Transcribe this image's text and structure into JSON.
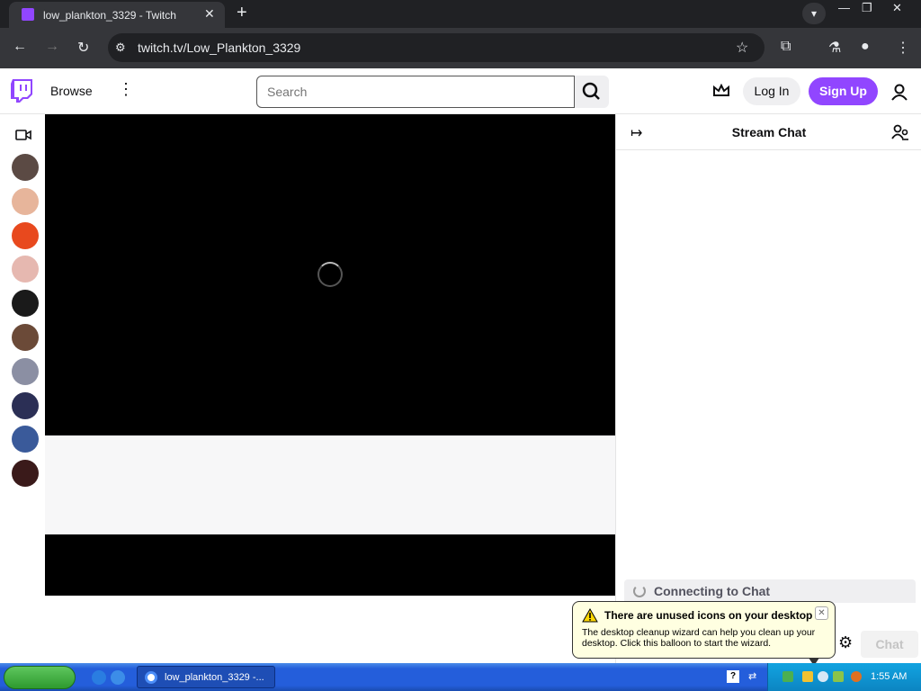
{
  "browser": {
    "tab_title": "low_plankton_3329 - Twitch",
    "tab_close": "✕",
    "new_tab": "+",
    "url": "twitch.tv/Low_Plankton_3329",
    "window_controls": {
      "minimize": "—",
      "restore": "❐",
      "close": "✕"
    },
    "nav": {
      "back": "←",
      "forward": "→",
      "reload": "↻"
    }
  },
  "twitch": {
    "nav": {
      "browse_label": "Browse",
      "search_placeholder": "Search",
      "login_label": "Log In",
      "signup_label": "Sign Up"
    },
    "sidebar": {
      "channels": [
        {
          "name": "avatar-1",
          "color": "#5b4a44"
        },
        {
          "name": "avatar-2",
          "color": "#e7b59b"
        },
        {
          "name": "avatar-3",
          "color": "#e8491e"
        },
        {
          "name": "avatar-4",
          "color": "#e6b8b0"
        },
        {
          "name": "avatar-5",
          "color": "#1a1a1a"
        },
        {
          "name": "avatar-6",
          "color": "#6b4a38"
        },
        {
          "name": "avatar-7",
          "color": "#8b8fa3"
        },
        {
          "name": "avatar-8",
          "color": "#2b2f55"
        },
        {
          "name": "avatar-9",
          "color": "#3a5a9a"
        },
        {
          "name": "avatar-10",
          "color": "#3a1a1a"
        }
      ]
    },
    "chat": {
      "title": "Stream Chat",
      "connecting_text": "Connecting to Chat",
      "chat_button": "Chat"
    },
    "colors": {
      "brand": "#9146ff",
      "player_bg": "#000000"
    }
  },
  "balloon": {
    "title": "There are unused icons on your desktop",
    "body": "The desktop cleanup wizard can help you clean up your desktop. Click this balloon to start the wizard.",
    "close": "✕"
  },
  "taskbar": {
    "task_label": "low_plankton_3329 -...",
    "clock": "1:55 AM",
    "help_icon": "?"
  }
}
